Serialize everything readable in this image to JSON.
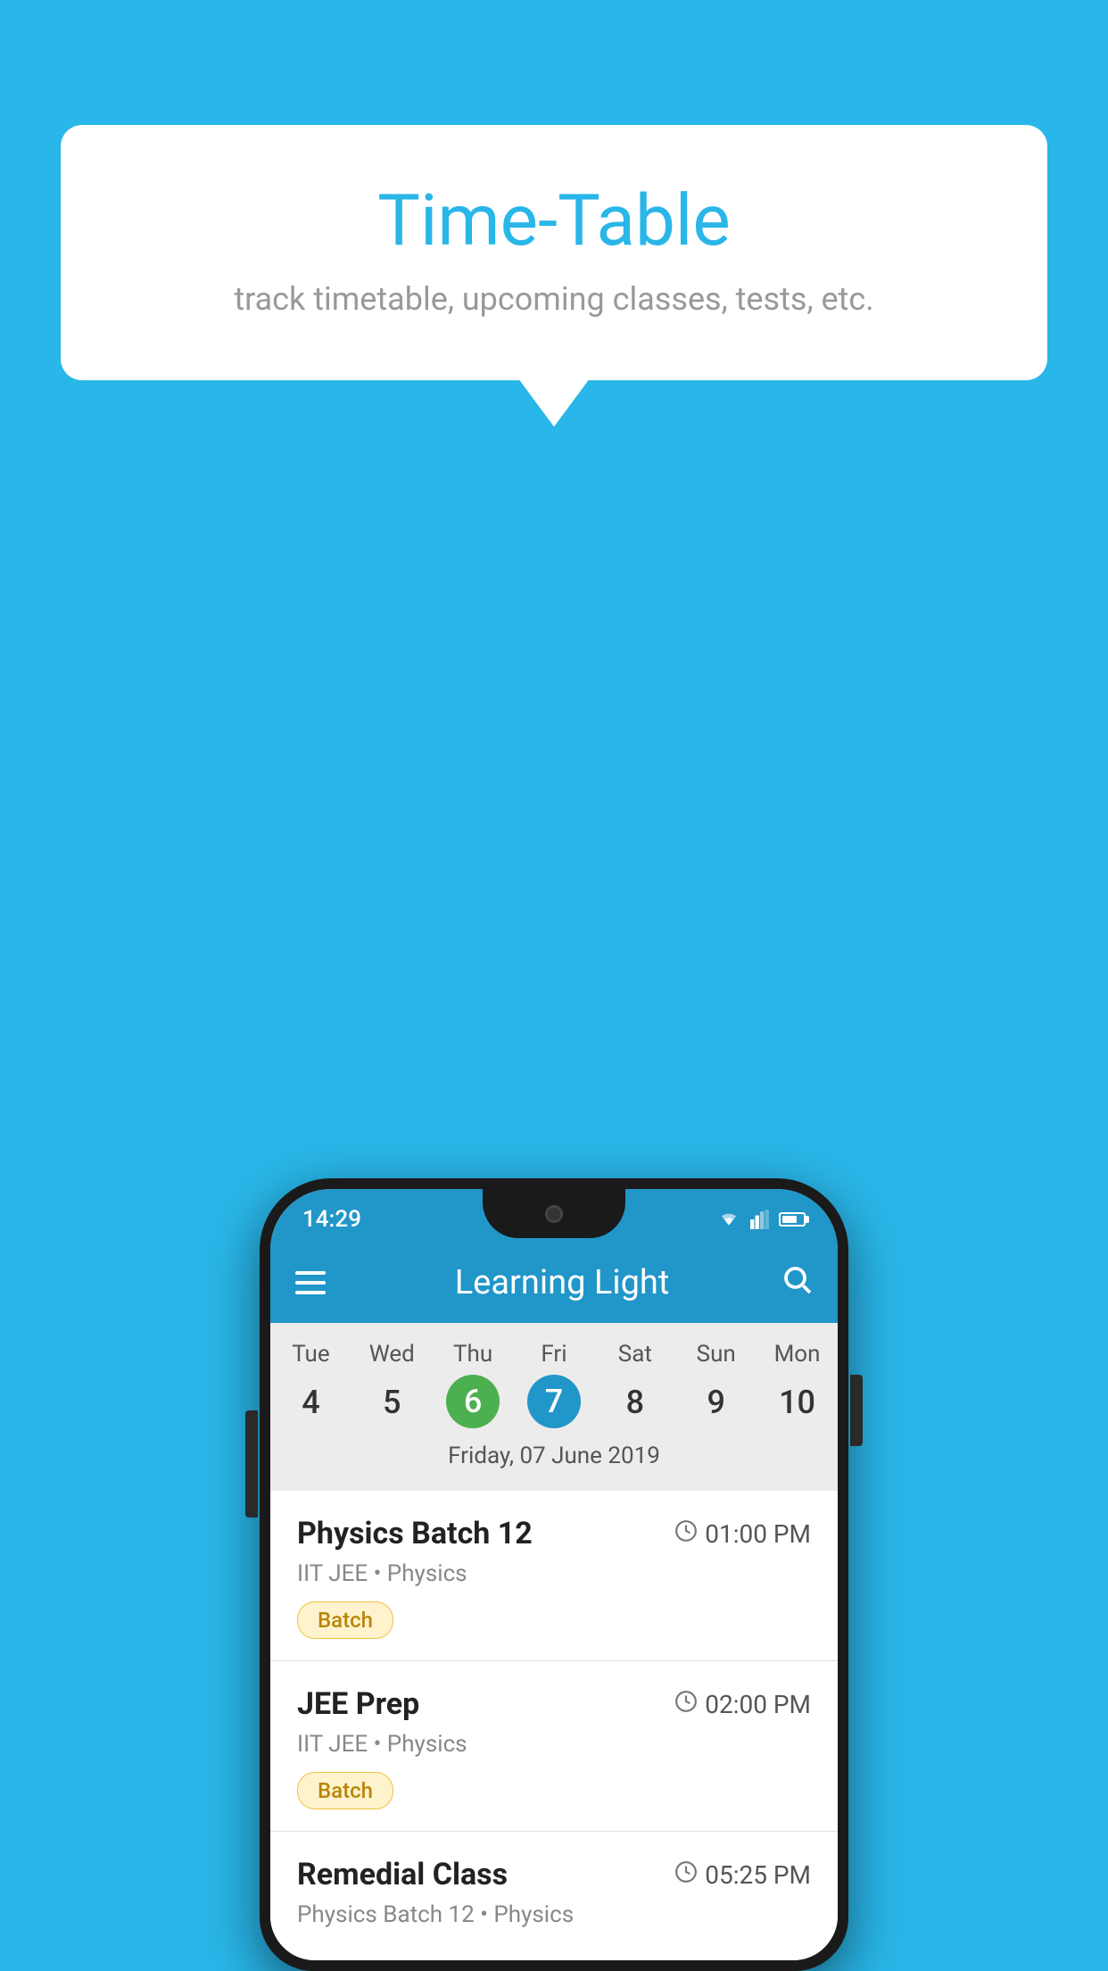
{
  "page": {
    "background_color": "#29B6E8"
  },
  "speech_bubble": {
    "title": "Time-Table",
    "subtitle": "track timetable, upcoming classes, tests, etc."
  },
  "status_bar": {
    "time": "14:29"
  },
  "app_bar": {
    "title": "Learning Light"
  },
  "calendar": {
    "days": [
      {
        "label": "Tue",
        "num": "4"
      },
      {
        "label": "Wed",
        "num": "5"
      },
      {
        "label": "Thu",
        "num": "6",
        "state": "today"
      },
      {
        "label": "Fri",
        "num": "7",
        "state": "selected"
      },
      {
        "label": "Sat",
        "num": "8"
      },
      {
        "label": "Sun",
        "num": "9"
      },
      {
        "label": "Mon",
        "num": "10"
      }
    ],
    "selected_date_label": "Friday, 07 June 2019"
  },
  "schedule": {
    "items": [
      {
        "title": "Physics Batch 12",
        "time": "01:00 PM",
        "subtitle": "IIT JEE • Physics",
        "tag": "Batch"
      },
      {
        "title": "JEE Prep",
        "time": "02:00 PM",
        "subtitle": "IIT JEE • Physics",
        "tag": "Batch"
      },
      {
        "title": "Remedial Class",
        "time": "05:25 PM",
        "subtitle": "Physics Batch 12 • Physics",
        "tag": null
      }
    ]
  }
}
